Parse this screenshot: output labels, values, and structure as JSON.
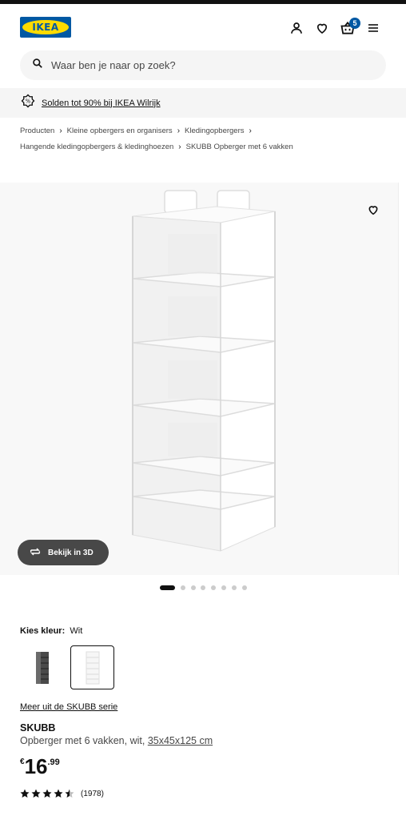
{
  "header": {
    "logo_text": "IKEA",
    "cart_count": "5",
    "icons": [
      "user-icon",
      "heart-icon",
      "cart-icon",
      "menu-icon"
    ],
    "brand_blue": "#0058a3",
    "brand_yellow": "#ffdb00"
  },
  "search": {
    "placeholder": "Waar ben je naar op zoek?"
  },
  "promo": {
    "text": "Solden tot 90% bij IKEA Wilrijk",
    "icon": "tag-icon"
  },
  "breadcrumb": {
    "items": [
      "Producten",
      "Kleine opbergers en organisers",
      "Kledingopbergers",
      "Hangende kledingopbergers & kledinghoezen",
      "SKUBB Opberger met 6 vakken"
    ]
  },
  "gallery": {
    "view_3d_label": "Bekijk in 3D",
    "image_count": 9,
    "active_index": 0
  },
  "color": {
    "label": "Kies kleur:",
    "value": "Wit",
    "options": [
      "dark-grey",
      "white"
    ],
    "selected": "white"
  },
  "product": {
    "series_link": "Meer uit de SKUBB serie",
    "name": "SKUBB",
    "description": "Opberger met 6 vakken, wit,",
    "dimensions": "35x45x125 cm",
    "price_currency": "€",
    "price_int": "16",
    "price_dec": ".99",
    "rating": 4.5,
    "review_count": "(1978)"
  }
}
